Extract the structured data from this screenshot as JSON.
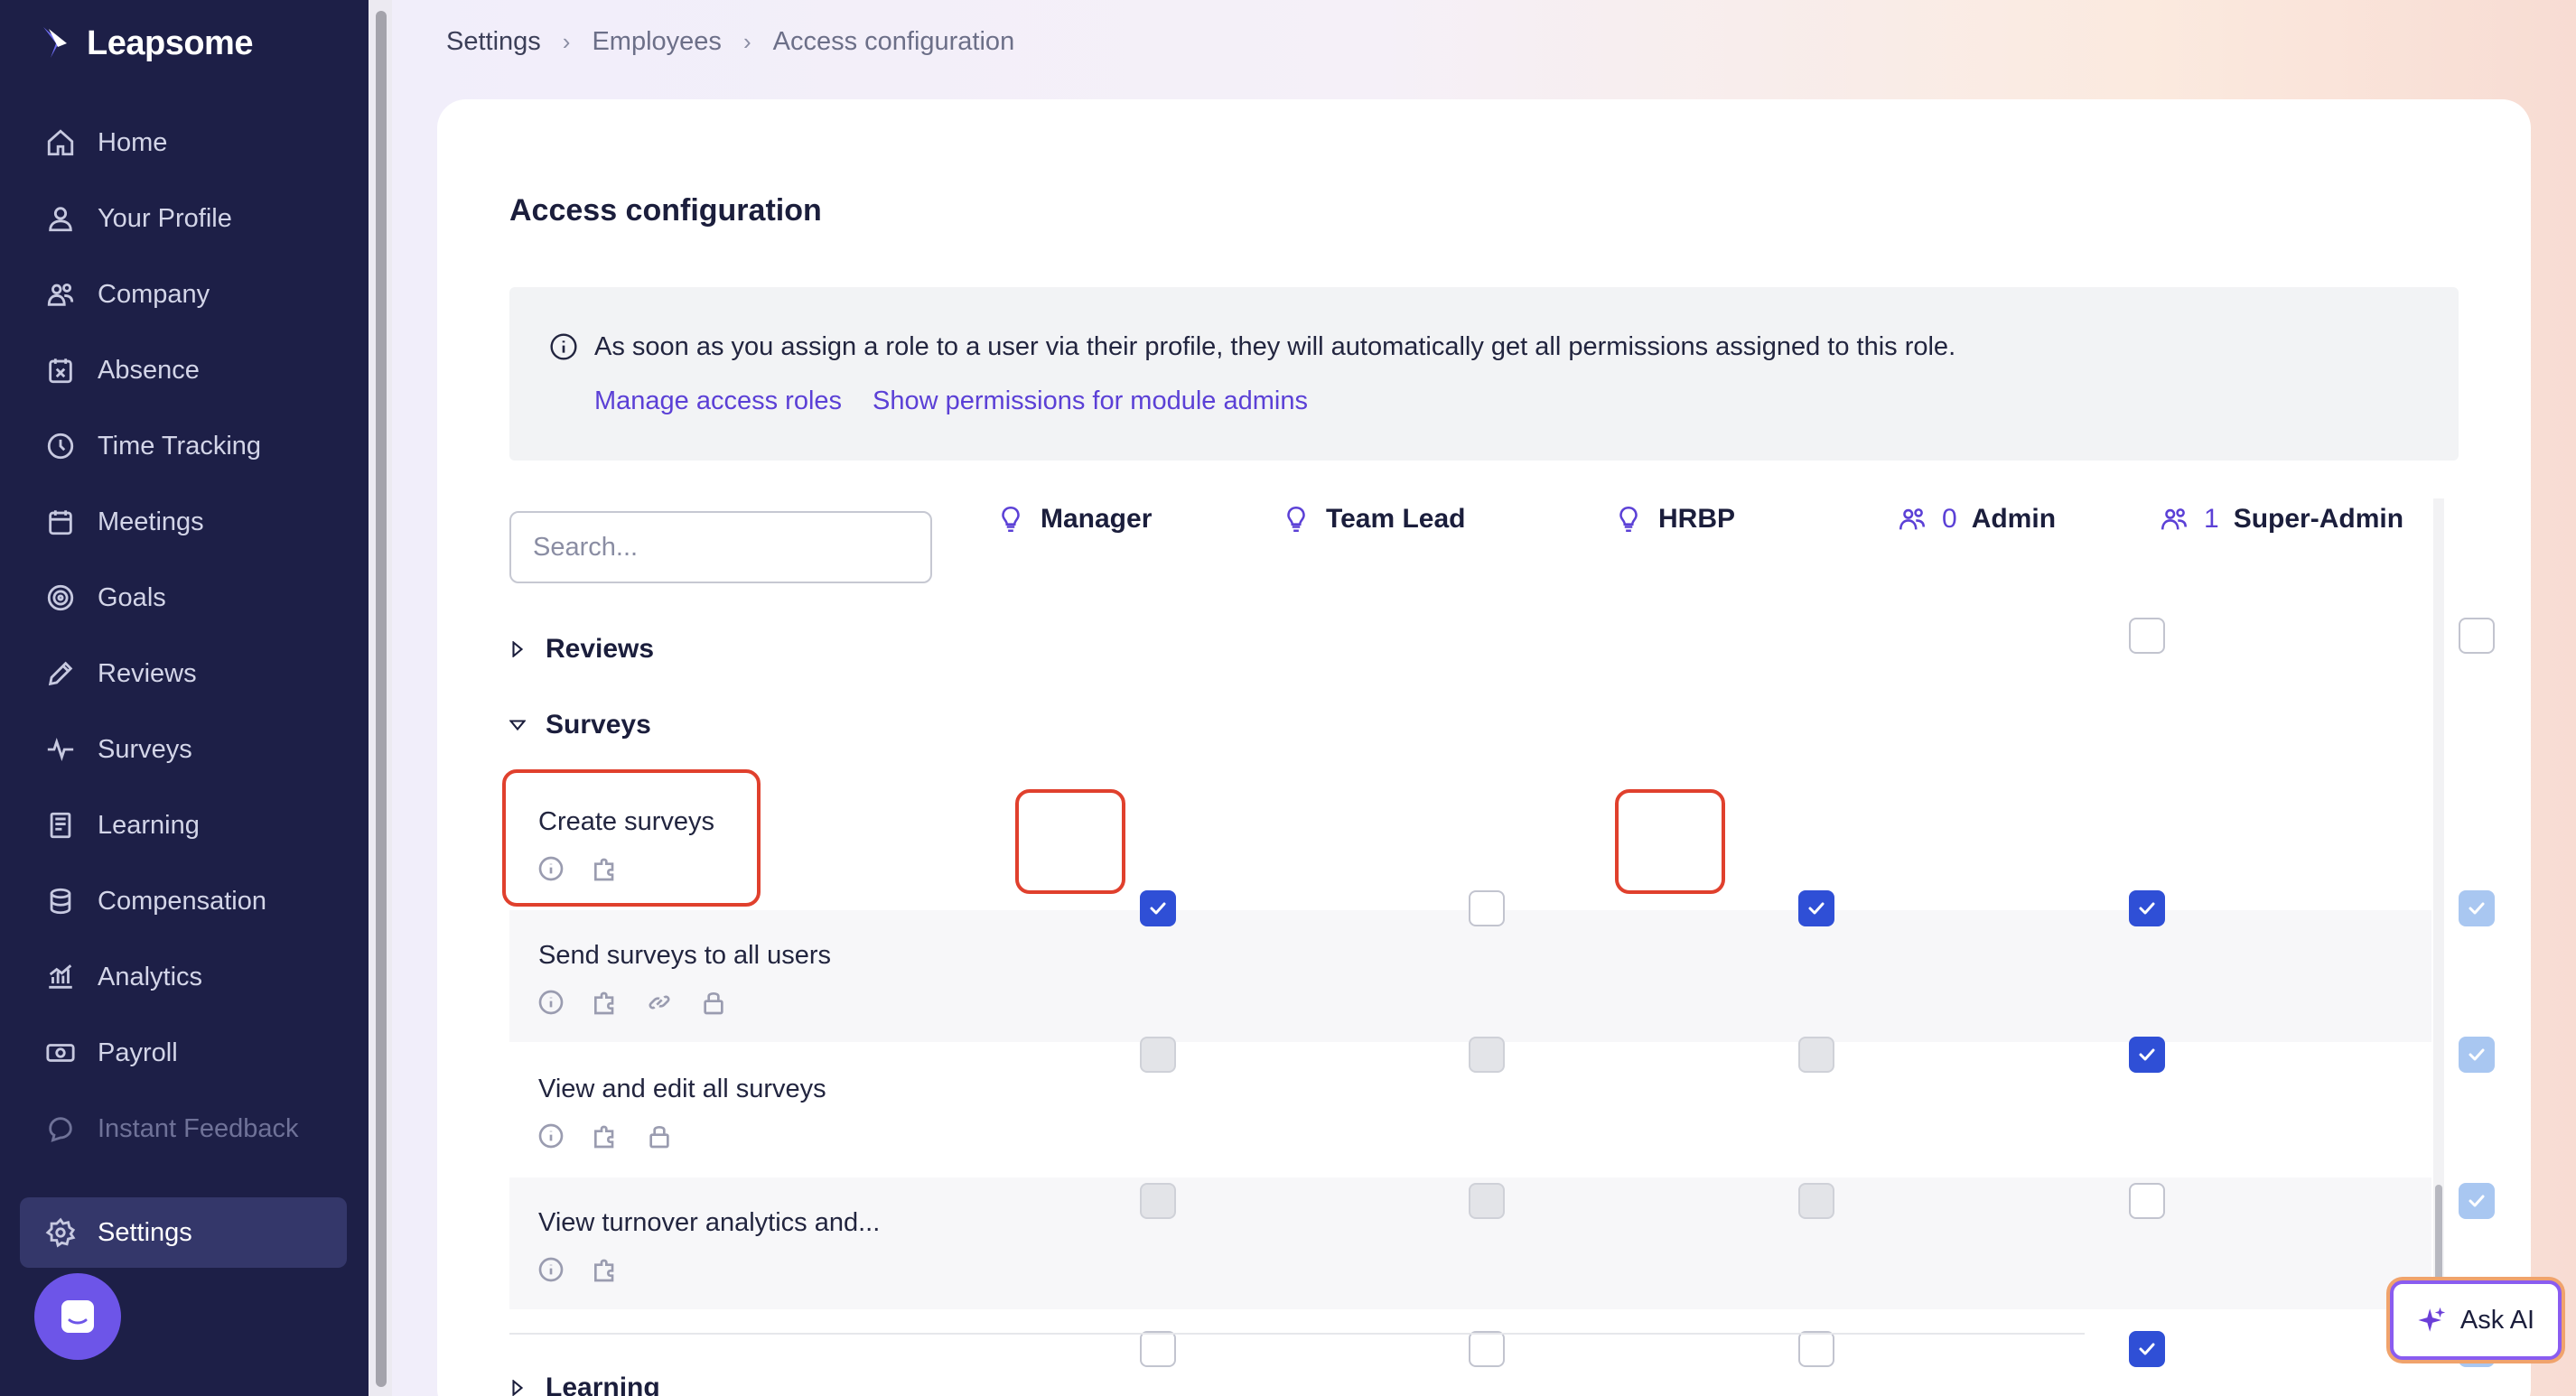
{
  "app": {
    "logo_text": "Leapsome"
  },
  "sidebar": {
    "items": [
      {
        "label": "Home",
        "icon": "home-icon"
      },
      {
        "label": "Your Profile",
        "icon": "user-icon"
      },
      {
        "label": "Company",
        "icon": "people-icon"
      },
      {
        "label": "Absence",
        "icon": "calendar-x-icon"
      },
      {
        "label": "Time Tracking",
        "icon": "clock-icon"
      },
      {
        "label": "Meetings",
        "icon": "calendar-icon"
      },
      {
        "label": "Goals",
        "icon": "target-icon"
      },
      {
        "label": "Reviews",
        "icon": "pencil-icon"
      },
      {
        "label": "Surveys",
        "icon": "pulse-icon"
      },
      {
        "label": "Learning",
        "icon": "book-icon"
      },
      {
        "label": "Compensation",
        "icon": "coins-icon"
      },
      {
        "label": "Analytics",
        "icon": "chart-icon"
      },
      {
        "label": "Payroll",
        "icon": "money-icon"
      },
      {
        "label": "Instant Feedback",
        "icon": "chat-icon"
      }
    ],
    "active_item": {
      "label": "Settings",
      "icon": "gear-icon"
    }
  },
  "breadcrumb": {
    "items": [
      "Settings",
      "Employees",
      "Access configuration"
    ]
  },
  "page": {
    "title": "Access configuration"
  },
  "info": {
    "text": "As soon as you assign a role to a user via their profile, they will automatically get all permissions assigned to this role.",
    "link_manage": "Manage access roles",
    "link_show": "Show permissions for module admins"
  },
  "search": {
    "placeholder": "Search..."
  },
  "columns": [
    {
      "label": "Manager",
      "count": ""
    },
    {
      "label": "Team Lead",
      "count": ""
    },
    {
      "label": "HRBP",
      "count": ""
    },
    {
      "label": "Admin",
      "count": "0"
    },
    {
      "label": "Super-Admin",
      "count": "1"
    }
  ],
  "sections": {
    "reviews": "Reviews",
    "surveys": "Surveys",
    "learning": "Learning"
  },
  "rows": [
    {
      "label": "Create surveys",
      "checks": [
        "checked",
        "unchecked",
        "checked",
        "checked",
        "faded"
      ]
    },
    {
      "label": "Send surveys to all users",
      "checks": [
        "disabled",
        "disabled",
        "disabled",
        "checked",
        "faded"
      ]
    },
    {
      "label": "View and edit all surveys",
      "checks": [
        "disabled",
        "disabled",
        "disabled",
        "unchecked",
        "faded"
      ]
    },
    {
      "label": "View turnover analytics and...",
      "checks": [
        "unchecked",
        "unchecked",
        "unchecked",
        "checked",
        "faded"
      ]
    }
  ],
  "ask_ai": {
    "label": "Ask AI"
  },
  "colors": {
    "accent": "#5b40d6",
    "checkbox": "#2f4fd6",
    "sidebar": "#1d1f47",
    "highlight": "#e0402d"
  }
}
